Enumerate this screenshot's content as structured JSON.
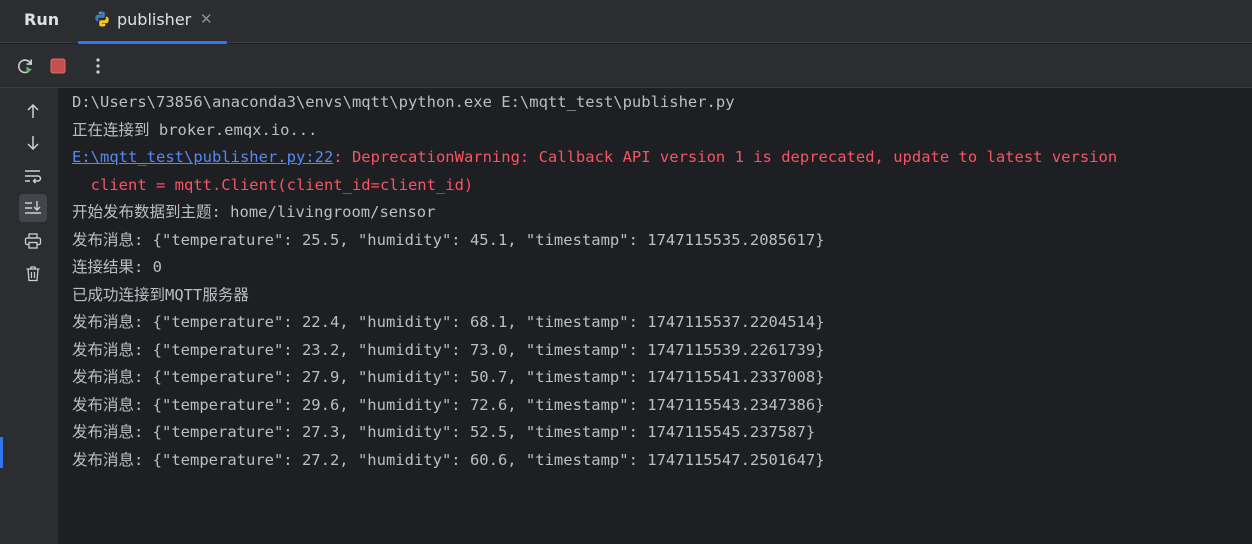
{
  "window": {
    "run_label": "Run",
    "tab": {
      "label": "publisher",
      "close_icon": "close-icon",
      "icon": "python-icon"
    }
  },
  "toolbar": {
    "rerun_icon": "rerun-icon",
    "stop_icon": "stop-icon",
    "more_icon": "more-options-icon"
  },
  "sidebar": {
    "items": [
      "up-arrow-icon",
      "down-arrow-icon",
      "soft-wrap-icon",
      "scroll-to-end-icon",
      "print-icon",
      "trash-icon"
    ],
    "active": "scroll-to-end-icon"
  },
  "console": {
    "lines": [
      "D:\\Users\\73856\\anaconda3\\envs\\mqtt\\python.exe E:\\mqtt_test\\publisher.py",
      "正在连接到 broker.emqx.io...",
      "",
      "  client = mqtt.Client(client_id=client_id)",
      "开始发布数据到主题: home/livingroom/sensor",
      "发布消息: {\"temperature\": 25.5, \"humidity\": 45.1, \"timestamp\": 1747115535.2085617}",
      "连接结果: 0",
      "已成功连接到MQTT服务器",
      "发布消息: {\"temperature\": 22.4, \"humidity\": 68.1, \"timestamp\": 1747115537.2204514}",
      "发布消息: {\"temperature\": 23.2, \"humidity\": 73.0, \"timestamp\": 1747115539.2261739}",
      "发布消息: {\"temperature\": 27.9, \"humidity\": 50.7, \"timestamp\": 1747115541.2337008}",
      "发布消息: {\"temperature\": 29.6, \"humidity\": 72.6, \"timestamp\": 1747115543.2347386}",
      "发布消息: {\"temperature\": 27.3, \"humidity\": 52.5, \"timestamp\": 1747115545.237587}",
      "发布消息: {\"temperature\": 27.2, \"humidity\": 60.6, \"timestamp\": 1747115547.2501647}"
    ],
    "warning": {
      "link": "E:\\mqtt_test\\publisher.py:22",
      "message": ": DeprecationWarning: Callback API version 1 is deprecated, update to latest version"
    }
  },
  "colors": {
    "background": "#1e1f22",
    "panel": "#2b2d30",
    "text": "#bcbec4",
    "error": "#f75464",
    "link": "#548af7",
    "accent": "#3574f0"
  }
}
